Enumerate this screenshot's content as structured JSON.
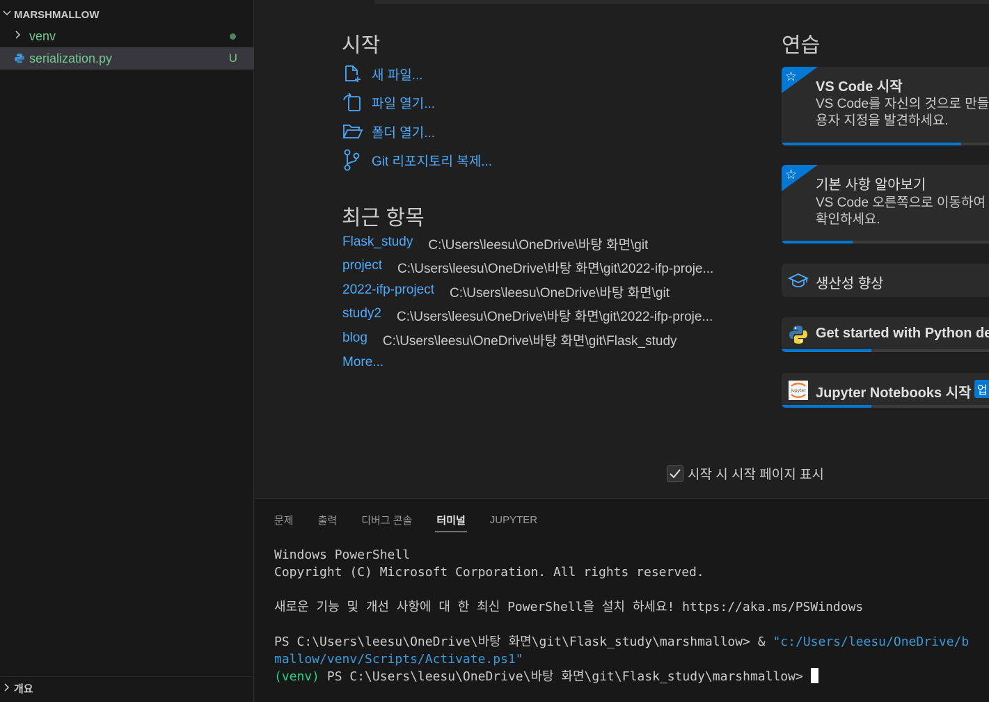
{
  "sidebar": {
    "folder_title": "MARSHMALLOW",
    "items": [
      {
        "label": "venv",
        "status": ""
      },
      {
        "label": "serialization.py",
        "status": "U"
      }
    ],
    "outline_label": "개요"
  },
  "welcome": {
    "start_heading": "시작",
    "start_items": [
      {
        "label": "새 파일...",
        "icon": "new-file-icon"
      },
      {
        "label": "파일 열기...",
        "icon": "open-file-icon"
      },
      {
        "label": "폴더 열기...",
        "icon": "open-folder-icon"
      },
      {
        "label": "Git 리포지토리 복제...",
        "icon": "git-branch-icon"
      }
    ],
    "recent_heading": "최근 항목",
    "recent": [
      {
        "name": "Flask_study",
        "path": "C:\\Users\\leesu\\OneDrive\\바탕 화면\\git"
      },
      {
        "name": "project",
        "path": "C:\\Users\\leesu\\OneDrive\\바탕 화면\\git\\2022-ifp-proje..."
      },
      {
        "name": "2022-ifp-project",
        "path": "C:\\Users\\leesu\\OneDrive\\바탕 화면\\git"
      },
      {
        "name": "study2",
        "path": "C:\\Users\\leesu\\OneDrive\\바탕 화면\\git\\2022-ifp-proje..."
      },
      {
        "name": "blog",
        "path": "C:\\Users\\leesu\\OneDrive\\바탕 화면\\git\\Flask_study"
      }
    ],
    "more_label": "More...",
    "walkthrough_heading": "연습",
    "walkthroughs": [
      {
        "title": "VS Code 시작",
        "desc1": "VS Code를 자신의 것으로 만들",
        "desc2": "용자 지정을 발견하세요.",
        "progress": 0.86
      },
      {
        "title": "기본 사항 알아보기",
        "desc1": "VS Code 오른쪽으로 이동하여",
        "desc2": "확인하세요.",
        "progress": 0.34
      },
      {
        "title": "생산성 향상"
      },
      {
        "title": "Get started with Python dev",
        "progress": 0.43
      },
      {
        "title": "Jupyter Notebooks 시작",
        "tag": "업",
        "progress": 0.43
      }
    ],
    "startup_checkbox_label": "시작 시 시작 페이지 표시",
    "startup_checked": true
  },
  "panel": {
    "tabs": [
      "문제",
      "출력",
      "디버그 콘솔",
      "터미널",
      "JUPYTER"
    ],
    "active_tab": "터미널",
    "terminal": {
      "line1": "Windows PowerShell",
      "line2": "Copyright (C) Microsoft Corporation. All rights reserved.",
      "line3": "새로운 기능 및 개선 사항에 대 한 최신 PowerShell을 설치 하세요! https://aka.ms/PSWindows",
      "line4_prompt": "PS C:\\Users\\leesu\\OneDrive\\바탕 화면\\git\\Flask_study\\marshmallow> & ",
      "line4_cmd": "\"c:/Users/leesu/OneDrive/b",
      "line5": "mallow/venv/Scripts/Activate.ps1\"",
      "line6_venv": "(venv)",
      "line6_prompt": " PS C:\\Users\\leesu\\OneDrive\\바탕 화면\\git\\Flask_study\\marshmallow> "
    }
  }
}
